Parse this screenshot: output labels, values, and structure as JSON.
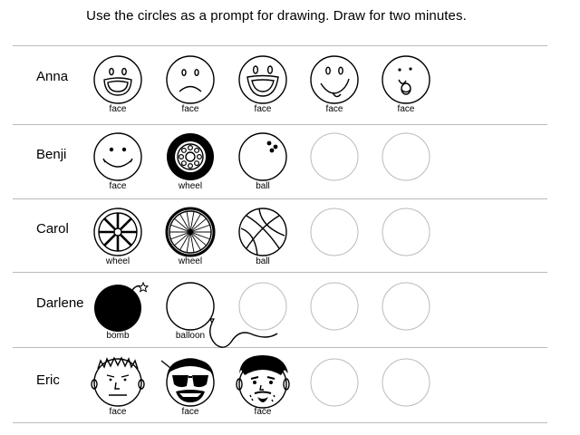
{
  "title": "Use the circles as a prompt for drawing.  Draw for two minutes.",
  "rows": [
    {
      "name": "Anna",
      "cells": [
        {
          "caption": "face",
          "drawing": "grinning-face-icon"
        },
        {
          "caption": "face",
          "drawing": "frowning-face-icon"
        },
        {
          "caption": "face",
          "drawing": "big-grin-face-icon"
        },
        {
          "caption": "face",
          "drawing": "tongue-out-face-icon"
        },
        {
          "caption": "face",
          "drawing": "surprised-face-icon"
        }
      ]
    },
    {
      "name": "Benji",
      "cells": [
        {
          "caption": "face",
          "drawing": "smiley-face-icon"
        },
        {
          "caption": "wheel",
          "drawing": "tire-wheel-icon"
        },
        {
          "caption": "ball",
          "drawing": "bowling-ball-icon"
        },
        {
          "caption": "",
          "drawing": "empty-circle"
        },
        {
          "caption": "",
          "drawing": "empty-circle"
        }
      ]
    },
    {
      "name": "Carol",
      "cells": [
        {
          "caption": "wheel",
          "drawing": "spoked-wheel-icon"
        },
        {
          "caption": "wheel",
          "drawing": "bicycle-wheel-icon"
        },
        {
          "caption": "ball",
          "drawing": "basketball-icon"
        },
        {
          "caption": "",
          "drawing": "empty-circle"
        },
        {
          "caption": "",
          "drawing": "empty-circle"
        }
      ]
    },
    {
      "name": "Darlene",
      "cells": [
        {
          "caption": "bomb",
          "drawing": "bomb-icon"
        },
        {
          "caption": "balloon",
          "drawing": "balloon-icon"
        },
        {
          "caption": "",
          "drawing": "empty-circle"
        },
        {
          "caption": "",
          "drawing": "empty-circle"
        },
        {
          "caption": "",
          "drawing": "empty-circle"
        }
      ]
    },
    {
      "name": "Eric",
      "cells": [
        {
          "caption": "face",
          "drawing": "spiky-hair-face-icon"
        },
        {
          "caption": "face",
          "drawing": "sunglasses-face-icon"
        },
        {
          "caption": "face",
          "drawing": "cap-goatee-face-icon"
        },
        {
          "caption": "",
          "drawing": "empty-circle"
        },
        {
          "caption": "",
          "drawing": "empty-circle"
        }
      ]
    }
  ]
}
